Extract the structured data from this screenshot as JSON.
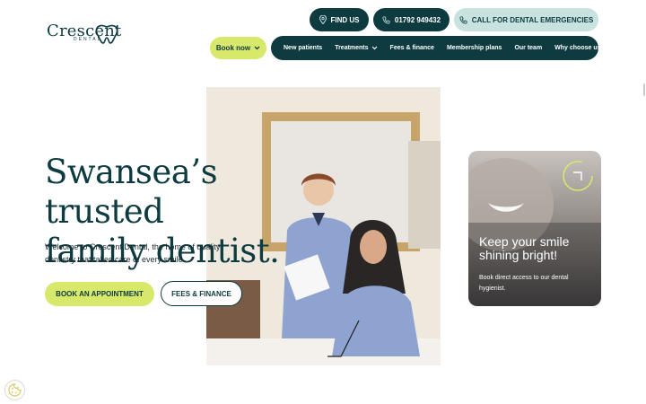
{
  "logo": {
    "wordmark": "Crescent",
    "subtext": "DENTAL"
  },
  "header": {
    "find_us": "FIND US",
    "phone": "01792 949432",
    "emergency": "CALL FOR DENTAL EMERGENCIES",
    "book_now": "Book now"
  },
  "nav": {
    "items": [
      {
        "label": "New patients"
      },
      {
        "label": "Treatments",
        "has_dropdown": true
      },
      {
        "label": "Fees & finance"
      },
      {
        "label": "Membership plans"
      },
      {
        "label": "Our team"
      },
      {
        "label": "Why choose us?"
      }
    ]
  },
  "hero": {
    "title_line1": "Swansea’s trusted",
    "title_line2": "family dentist.",
    "description": "Welcome to Crescent Dental, the home of quality dentistry that takes care of every smile.",
    "cta_primary": "BOOK AN APPOINTMENT",
    "cta_secondary": "FEES & FINANCE"
  },
  "promo_card": {
    "title": "Keep your smile shining bright!",
    "text": "Book direct access to our dental hygienist."
  },
  "colors": {
    "brand_dark": "#0d3b40",
    "accent_lime": "#d8e86a",
    "accent_mint": "#c8e3df"
  },
  "icons": {
    "find_us": "map-pin-icon",
    "phone": "phone-icon",
    "emergency": "phone-icon",
    "card_arrow": "arrow-up-right-icon",
    "cookie": "cookie-icon"
  }
}
